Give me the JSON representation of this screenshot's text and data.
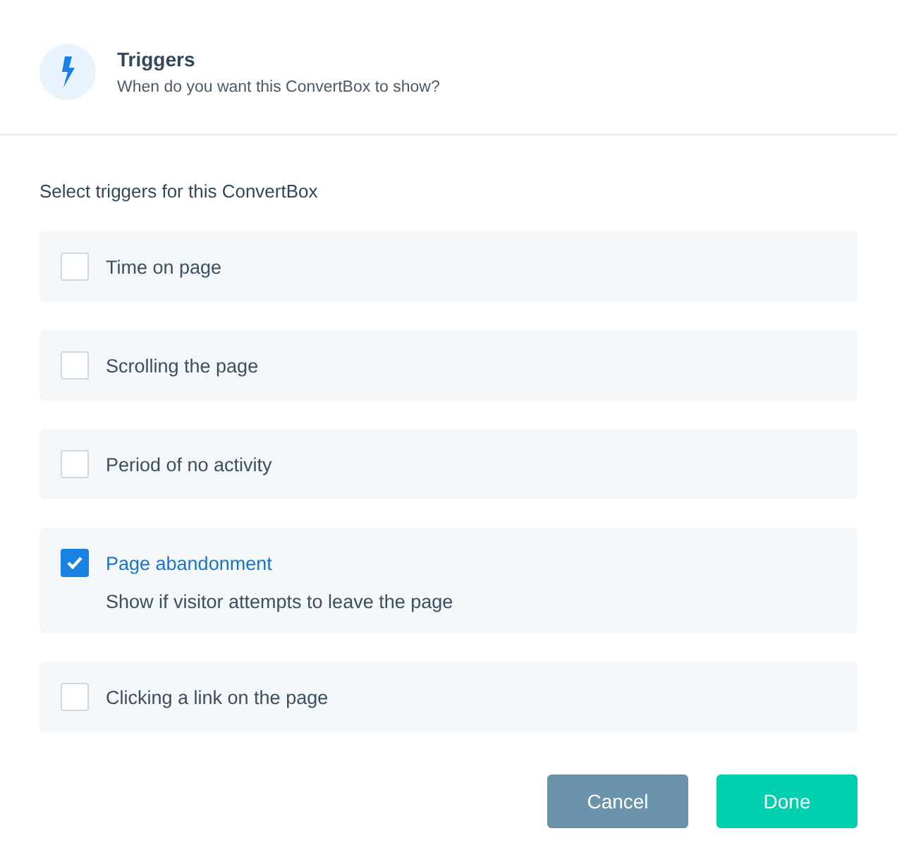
{
  "header": {
    "title": "Triggers",
    "subtitle": "When do you want this ConvertBox to show?"
  },
  "section_label": "Select triggers for this ConvertBox",
  "triggers": [
    {
      "label": "Time on page",
      "checked": false
    },
    {
      "label": "Scrolling the page",
      "checked": false
    },
    {
      "label": "Period of no activity",
      "checked": false
    },
    {
      "label": "Page abandonment",
      "checked": true,
      "description": "Show if visitor attempts to leave the page"
    },
    {
      "label": "Clicking a link on the page",
      "checked": false
    }
  ],
  "buttons": [
    {
      "label": "Cancel",
      "kind": "secondary"
    },
    {
      "label": "Done",
      "kind": "primary"
    }
  ]
}
